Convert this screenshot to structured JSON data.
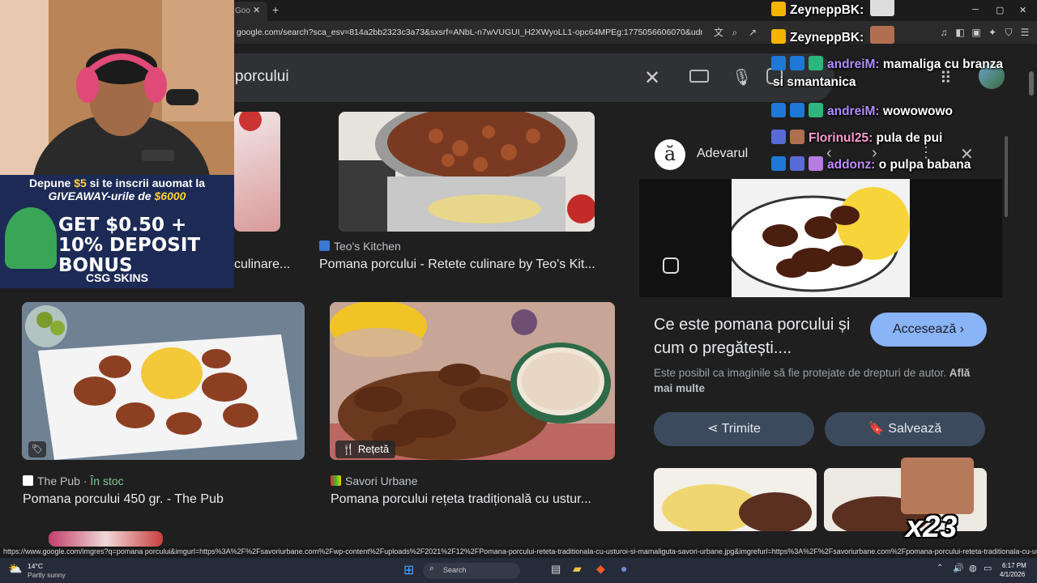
{
  "browser": {
    "tab_label": "Goo",
    "tab_close": "✕",
    "new_tab": "+",
    "url": "google.com/search?sca_esv=814a2bb2323c3a73&sxsrf=ANbL-n7wVUGUI_H2XWyoLL1-opc64MPEg:1775056606070&udm=2&fbs=ADc_l...",
    "win_min": "─",
    "win_max": "▢",
    "win_close": "✕",
    "status_url": "https://www.google.com/imgres?q=pomana porcului&imgurl=https%3A%2F%2Fsavoriurbane.com%2Fwp-content%2Fuploads%2F2021%2F12%2FPomana-porcului-reteta-traditionala-cu-usturoi-si-mamaliguta-savori-urbane.jpg&imgrefurl=https%3A%2F%2Fsavoriurbane.com%2Fpomana-porcului-reteta-traditionala-cu-usturoi-si-mamaliguta-si-muraturi..."
  },
  "search": {
    "query": "porcului",
    "clear_icon": "✕"
  },
  "results": [
    {
      "source": "",
      "caption": "culinare..."
    },
    {
      "source": "Teo's Kitchen",
      "caption": "Pomana porcului - Retete culinare by Teo's Kit..."
    },
    {
      "source": "The Pub",
      "stock": "În stoc",
      "sep": "·",
      "caption": "Pomana porcului 450 gr. - The Pub"
    },
    {
      "source": "Savori Urbane",
      "caption": "Pomana porcului rețeta tradițională cu ustur...",
      "tag": "Rețetă"
    }
  ],
  "panel": {
    "site": "Adevarul",
    "logo_letter": "ă",
    "title": "Ce este pomana porcului și cum o pregătești....",
    "access": "Accesează ›",
    "copyright": "Este posibil ca imaginile să fie protejate de drepturi de autor.",
    "learn_more": "Află mai multe",
    "share": "Trimite",
    "save": "Salvează"
  },
  "overlay": {
    "banner_line1_a": "Depune ",
    "banner_line1_amt": "$5",
    "banner_line1_b": " si te inscrii auomat la",
    "banner_line2_a": "GIVEAWAY-urile de ",
    "banner_line2_amt": "$6000",
    "bonus": "GET $0.50 + 10% DEPOSIT BONUS",
    "brand": "CSG SKINS",
    "multiplier": "x23"
  },
  "chat": [
    {
      "user": "ZeyneppBK:",
      "msg": "",
      "color": "#ffffff"
    },
    {
      "user": "ZeyneppBK:",
      "msg": "",
      "color": "#ffffff"
    },
    {
      "user": "andreiM:",
      "msg": "mamaliga cu branza",
      "color": "#b08cff"
    },
    {
      "user": "",
      "msg": "si smantanica",
      "color": "#ffffff"
    },
    {
      "user": "andreiM:",
      "msg": "wowowowo",
      "color": "#b08cff"
    },
    {
      "user": "Florinul25:",
      "msg": "pula de pui",
      "color": "#ff9bd0"
    },
    {
      "user": "addonz:",
      "msg": "o pulpa babana",
      "color": "#c08bff"
    }
  ],
  "taskbar": {
    "temp": "14°C",
    "weather": "Partly sunny",
    "search": "Search",
    "time": "6:17 PM",
    "date": "4/1/2026"
  }
}
